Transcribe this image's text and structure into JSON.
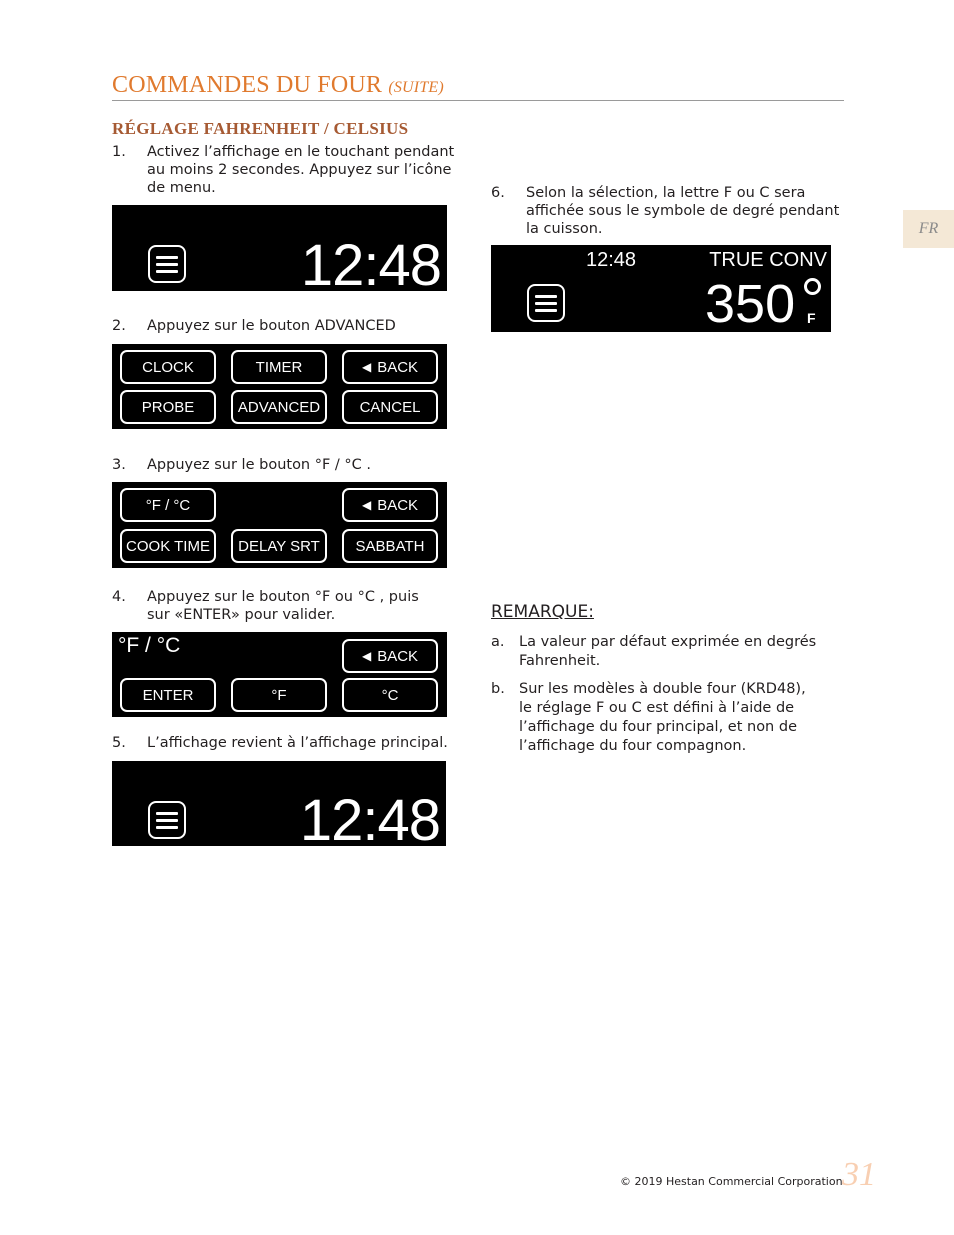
{
  "header": {
    "title": "COMMANDES DU FOUR",
    "title_suffix": "(SUITE)",
    "section_title": "RÉGLAGE FAHRENHEIT / CELSIUS"
  },
  "lang_tab": "FR",
  "steps": [
    {
      "num": "1.",
      "text": "Activez l’affichage en le touchant pendant\nau moins 2 secondes.  Appuyez sur l’icône\nde menu."
    },
    {
      "num": "2.",
      "text": "Appuyez sur le bouton    ADVANCED"
    },
    {
      "num": "3.",
      "text": "Appuyez sur le bouton    °F / °C    ."
    },
    {
      "num": "4.",
      "text": "Appuyez sur le bouton    °F    ou    °C   , puis\nsur «ENTER» pour valider."
    },
    {
      "num": "5.",
      "text": "L’affichage revient à l’affichage principal."
    },
    {
      "num": "6.",
      "text": "Selon la sélection, la lettre F ou C sera\naffichée sous le symbole de degré pendant\nla cuisson."
    }
  ],
  "screens": {
    "home1": {
      "clock": "12:48"
    },
    "menu": {
      "buttons": [
        "CLOCK",
        "TIMER",
        "BACK",
        "PROBE",
        "ADVANCED",
        "CANCEL"
      ]
    },
    "advanced": {
      "buttons": [
        "°F / °C",
        "BACK",
        "COOK TIME",
        "DELAY SRT",
        "SABBATH"
      ]
    },
    "units": {
      "label": "°F / °C",
      "buttons": [
        "BACK",
        "ENTER",
        "°F",
        "°C"
      ]
    },
    "home2": {
      "clock": "12:48"
    },
    "cooking": {
      "clock": "12:48",
      "mode": "TRUE CONV",
      "temperature": "350",
      "degree": "o",
      "unit": "F"
    }
  },
  "notes": {
    "title": "REMARQUE:",
    "items": [
      {
        "num": "a.",
        "text": "La valeur par défaut exprimée en degrés\nFahrenheit."
      },
      {
        "num": "b.",
        "text": "Sur les modèles à double four (KRD48),\nle réglage F ou C est défini à l’aide de\nl’affichage du four principal, et non de\nl’affichage du four compagnon."
      }
    ]
  },
  "footer": {
    "copyright": "© 2019 Hestan Commercial Corporation",
    "page_number": "31"
  }
}
